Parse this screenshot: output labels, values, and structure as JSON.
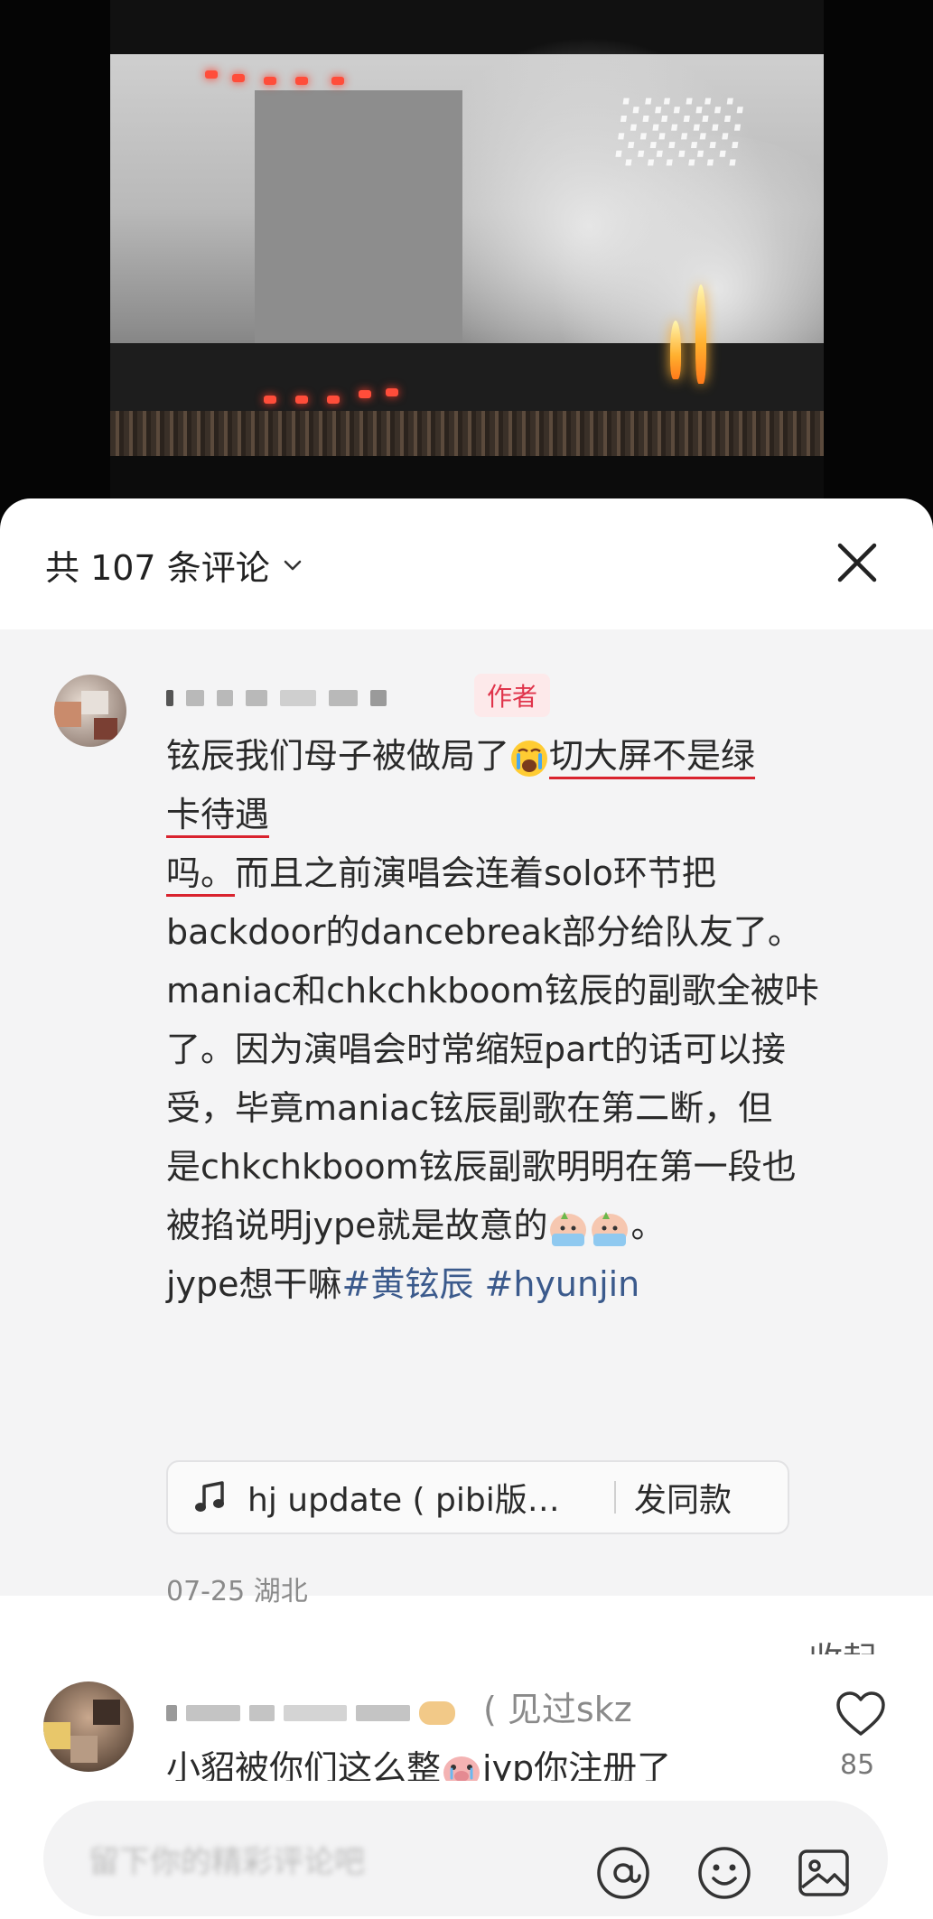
{
  "comments_header": {
    "count_label": "共 107 条评论"
  },
  "author_comment": {
    "badge": "作者",
    "lines": {
      "l1a": "铉辰我们母子被做局了",
      "l1b": "切大屏不是绿",
      "l2": "卡待遇",
      "l3a": "吗。",
      "l3b": "而且之前演唱会连着solo环节把",
      "l4": "backdoor的dancebreak部分给队友了。",
      "l5": "maniac和chkchkboom铉辰的副歌全被咔",
      "l6": "了。因为演唱会时常缩短part的话可以接",
      "l7": "受，毕竟maniac铉辰副歌在第二断，但",
      "l8": "是chkchkboom铉辰副歌明明在第一段也",
      "l9a": "被掐说明jype就是故意的",
      "l9b": "。",
      "l10a": "jype想干嘛",
      "tag1": "#黄铉辰",
      "tag2": "#hyunjin"
    },
    "music_chip": {
      "song": "hj update ( pibi版…",
      "use_label": "发同款"
    },
    "date_location": "07-25 湖北",
    "collapse_label": "收起"
  },
  "second_comment": {
    "seen_label": "( 见过skz",
    "text_a": "小貂被你们这么整",
    "text_b": "jyp你注册了",
    "like_count": "85"
  },
  "input_bar": {
    "placeholder": "留下你的精彩评论吧"
  },
  "icons": {
    "chevron": "chevron-down-icon",
    "close": "close-icon",
    "music": "music-note-icon",
    "like": "heart-icon",
    "mention": "at-icon",
    "emoji": "smiley-icon",
    "image": "image-icon"
  },
  "colors": {
    "author_badge_text": "#e0344b",
    "author_badge_bg": "#fde9ea",
    "hashtag": "#3b5a8c",
    "author_block_bg": "#f4f4f5",
    "underline_annotation": "#d9232e"
  }
}
